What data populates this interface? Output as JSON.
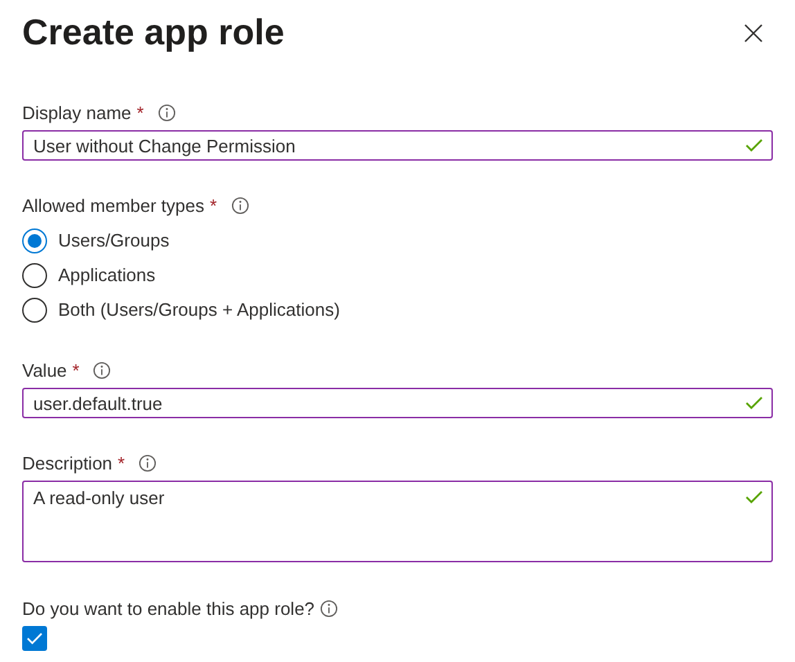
{
  "panel": {
    "title": "Create app role"
  },
  "display_name": {
    "label": "Display name",
    "required_mark": "*",
    "value": "User without Change Permission",
    "valid": true
  },
  "member_types": {
    "label": "Allowed member types",
    "required_mark": "*",
    "options": [
      {
        "label": "Users/Groups",
        "selected": true
      },
      {
        "label": "Applications",
        "selected": false
      },
      {
        "label": "Both (Users/Groups + Applications)",
        "selected": false
      }
    ]
  },
  "value": {
    "label": "Value",
    "required_mark": "*",
    "value": "user.default.true",
    "valid": true
  },
  "description": {
    "label": "Description",
    "required_mark": "*",
    "value": "A read-only user",
    "valid": true
  },
  "enable": {
    "label": "Do you want to enable this app role?",
    "checked": true
  }
}
